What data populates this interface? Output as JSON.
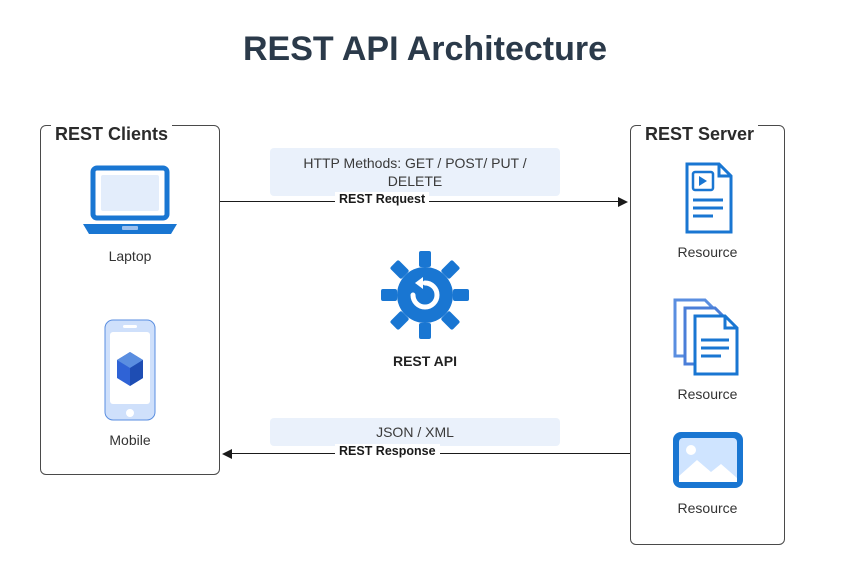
{
  "title": "REST API Architecture",
  "clients": {
    "panel_title": "REST Clients",
    "laptop_label": "Laptop",
    "mobile_label": "Mobile"
  },
  "server": {
    "panel_title": "REST Server",
    "resource1_label": "Resource",
    "resource2_label": "Resource",
    "resource3_label": "Resource"
  },
  "center": {
    "api_label": "REST API"
  },
  "flow": {
    "http_methods": "HTTP Methods: GET / POST/ PUT / DELETE",
    "request_label": "REST Request",
    "response_format": "JSON / XML",
    "response_label": "REST Response"
  },
  "colors": {
    "primary_blue": "#1976d2",
    "light_blue": "#eaf1fb",
    "dark_text": "#2b3a4a"
  }
}
